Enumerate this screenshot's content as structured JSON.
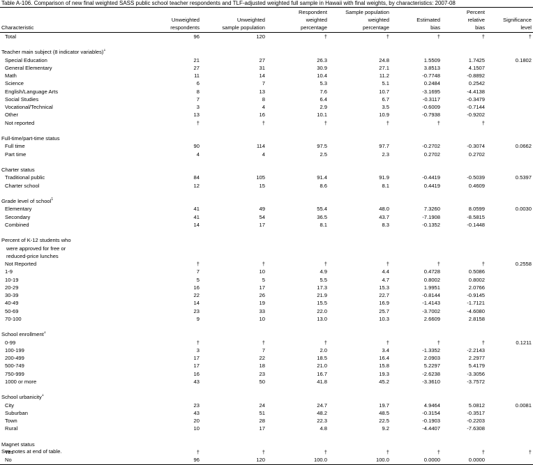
{
  "title": "Table A-106. Comparison of new final weighted SASS public school teacher respondents and TLF-adjusted weighted full sample in Hawaii with final weights, by characteristics: 2007-08",
  "headers": [
    [
      "Characteristic"
    ],
    [
      "Unweighted",
      "respondents"
    ],
    [
      "Unweighted",
      "sample population"
    ],
    [
      "Respondent",
      "weighted",
      "percentage"
    ],
    [
      "Sample population",
      "weighted",
      "percentage"
    ],
    [
      "Estimated",
      "bias"
    ],
    [
      "Percent",
      "relative",
      "bias"
    ],
    [
      "Significance",
      "level"
    ]
  ],
  "rows": [
    {
      "type": "item",
      "label": "Total",
      "v": [
        "96",
        "120",
        "†",
        "†",
        "†",
        "†",
        "†"
      ]
    },
    {
      "type": "blank"
    },
    {
      "type": "sec",
      "label": "Teacher main subject (8 indicator variables)",
      "sup": "1"
    },
    {
      "type": "item",
      "label": "Special Education",
      "v": [
        "21",
        "27",
        "26.3",
        "24.8",
        "1.5509",
        "1.7425",
        "0.1802"
      ]
    },
    {
      "type": "item",
      "label": "General Elementary",
      "v": [
        "27",
        "31",
        "30.9",
        "27.1",
        "3.8513",
        "4.1507",
        ""
      ]
    },
    {
      "type": "item",
      "label": "Math",
      "v": [
        "11",
        "14",
        "10.4",
        "11.2",
        "-0.7748",
        "-0.8892",
        ""
      ]
    },
    {
      "type": "item",
      "label": "Science",
      "v": [
        "6",
        "7",
        "5.3",
        "5.1",
        "0.2484",
        "0.2542",
        ""
      ]
    },
    {
      "type": "item",
      "label": "English/Language Arts",
      "v": [
        "8",
        "13",
        "7.6",
        "10.7",
        "-3.1695",
        "-4.4138",
        ""
      ]
    },
    {
      "type": "item",
      "label": "Social Studies",
      "v": [
        "7",
        "8",
        "6.4",
        "6.7",
        "-0.3117",
        "-0.3479",
        ""
      ]
    },
    {
      "type": "item",
      "label": "Vocational/Technical",
      "v": [
        "3",
        "4",
        "2.9",
        "3.5",
        "-0.6009",
        "-0.7144",
        ""
      ]
    },
    {
      "type": "item",
      "label": "Other",
      "v": [
        "13",
        "16",
        "10.1",
        "10.9",
        "-0.7938",
        "-0.9202",
        ""
      ]
    },
    {
      "type": "item",
      "label": "Not reported",
      "v": [
        "†",
        "†",
        "†",
        "†",
        "†",
        "†",
        ""
      ]
    },
    {
      "type": "blank"
    },
    {
      "type": "sec",
      "label": "Full-time/part-time status"
    },
    {
      "type": "item",
      "label": "Full time",
      "v": [
        "90",
        "114",
        "97.5",
        "97.7",
        "-0.2702",
        "-0.3074",
        "0.0662"
      ]
    },
    {
      "type": "item",
      "label": "Part time",
      "v": [
        "4",
        "4",
        "2.5",
        "2.3",
        "0.2702",
        "0.2702",
        ""
      ]
    },
    {
      "type": "blank"
    },
    {
      "type": "sec",
      "label": "Charter status"
    },
    {
      "type": "item",
      "label": "Traditional public",
      "v": [
        "84",
        "105",
        "91.4",
        "91.9",
        "-0.4419",
        "-0.5039",
        "0.5397"
      ]
    },
    {
      "type": "item",
      "label": "Charter school",
      "v": [
        "12",
        "15",
        "8.6",
        "8.1",
        "0.4419",
        "0.4609",
        ""
      ]
    },
    {
      "type": "blank"
    },
    {
      "type": "sec",
      "label": "Grade level of school",
      "sup": "1"
    },
    {
      "type": "item",
      "label": "Elementary",
      "v": [
        "41",
        "49",
        "55.4",
        "48.0",
        "7.3260",
        "8.0599",
        "0.0030"
      ]
    },
    {
      "type": "item",
      "label": "Secondary",
      "v": [
        "41",
        "54",
        "36.5",
        "43.7",
        "-7.1908",
        "-8.5815",
        ""
      ]
    },
    {
      "type": "item",
      "label": "Combined",
      "v": [
        "14",
        "17",
        "8.1",
        "8.3",
        "-0.1352",
        "-0.1448",
        ""
      ]
    },
    {
      "type": "blank"
    },
    {
      "type": "sec",
      "label": "Percent of K-12 students who"
    },
    {
      "type": "sub",
      "label": "were approved for free or"
    },
    {
      "type": "sub",
      "label": "reduced-price lunches"
    },
    {
      "type": "item",
      "label": "Not Reported",
      "v": [
        "†",
        "†",
        "†",
        "†",
        "†",
        "†",
        "0.2558"
      ]
    },
    {
      "type": "item",
      "label": "1-9",
      "v": [
        "7",
        "10",
        "4.9",
        "4.4",
        "0.4728",
        "0.5086",
        ""
      ]
    },
    {
      "type": "item",
      "label": "10-19",
      "v": [
        "5",
        "5",
        "5.5",
        "4.7",
        "0.8002",
        "0.8002",
        ""
      ]
    },
    {
      "type": "item",
      "label": "20-29",
      "v": [
        "16",
        "17",
        "17.3",
        "15.3",
        "1.9951",
        "2.0766",
        ""
      ]
    },
    {
      "type": "item",
      "label": "30-39",
      "v": [
        "22",
        "26",
        "21.9",
        "22.7",
        "-0.8144",
        "-0.9145",
        ""
      ]
    },
    {
      "type": "item",
      "label": "40-49",
      "v": [
        "14",
        "19",
        "15.5",
        "16.9",
        "-1.4143",
        "-1.7121",
        ""
      ]
    },
    {
      "type": "item",
      "label": "50-69",
      "v": [
        "23",
        "33",
        "22.0",
        "25.7",
        "-3.7002",
        "-4.6080",
        ""
      ]
    },
    {
      "type": "item",
      "label": "70-100",
      "v": [
        "9",
        "10",
        "13.0",
        "10.3",
        "2.6609",
        "2.8158",
        ""
      ]
    },
    {
      "type": "blank"
    },
    {
      "type": "sec",
      "label": "School enrollment",
      "sup": "1"
    },
    {
      "type": "item",
      "label": "0-99",
      "v": [
        "†",
        "†",
        "†",
        "†",
        "†",
        "†",
        "0.1211"
      ]
    },
    {
      "type": "item",
      "label": "100-199",
      "v": [
        "3",
        "7",
        "2.0",
        "3.4",
        "-1.3352",
        "-2.2143",
        ""
      ]
    },
    {
      "type": "item",
      "label": "200-499",
      "v": [
        "17",
        "22",
        "18.5",
        "16.4",
        "2.0903",
        "2.2977",
        ""
      ]
    },
    {
      "type": "item",
      "label": "500-749",
      "v": [
        "17",
        "18",
        "21.0",
        "15.8",
        "5.2297",
        "5.4179",
        ""
      ]
    },
    {
      "type": "item",
      "label": "750-999",
      "v": [
        "16",
        "23",
        "16.7",
        "19.3",
        "-2.6238",
        "-3.3056",
        ""
      ]
    },
    {
      "type": "item",
      "label": "1000 or more",
      "v": [
        "43",
        "50",
        "41.8",
        "45.2",
        "-3.3610",
        "-3.7572",
        ""
      ]
    },
    {
      "type": "blank"
    },
    {
      "type": "sec",
      "label": "School urbanicity",
      "sup": "1"
    },
    {
      "type": "item",
      "label": "City",
      "v": [
        "23",
        "24",
        "24.7",
        "19.7",
        "4.9464",
        "5.0812",
        "0.0081"
      ]
    },
    {
      "type": "item",
      "label": "Suburban",
      "v": [
        "43",
        "51",
        "48.2",
        "48.5",
        "-0.3154",
        "-0.3517",
        ""
      ]
    },
    {
      "type": "item",
      "label": "Town",
      "v": [
        "20",
        "28",
        "22.3",
        "22.5",
        "-0.1903",
        "-0.2203",
        ""
      ]
    },
    {
      "type": "item",
      "label": "Rural",
      "v": [
        "10",
        "17",
        "4.8",
        "9.2",
        "-4.4407",
        "-7.6308",
        ""
      ]
    },
    {
      "type": "blank"
    },
    {
      "type": "sec",
      "label": "Magnet status"
    },
    {
      "type": "item",
      "label": "Yes",
      "v": [
        "†",
        "†",
        "†",
        "†",
        "†",
        "†",
        "†"
      ]
    },
    {
      "type": "item",
      "label": "No",
      "v": [
        "96",
        "120",
        "100.0",
        "100.0",
        "0.0000",
        "0.0000",
        ""
      ],
      "last": true
    }
  ],
  "footnote": "See notes at end of table."
}
